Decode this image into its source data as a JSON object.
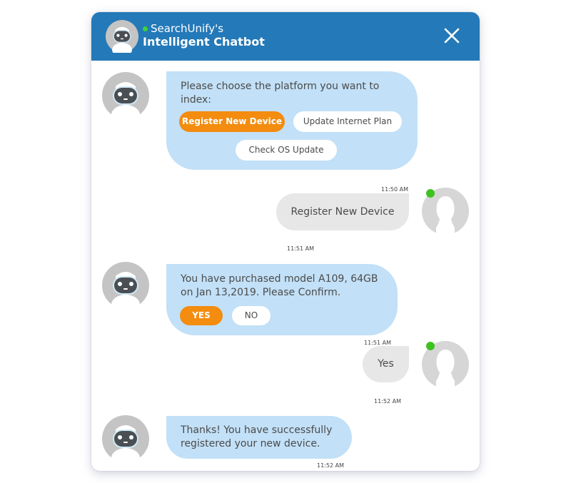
{
  "header": {
    "brand": "SearchUnify's",
    "title": "Intelligent Chatbot",
    "online_color": "#3fd13a",
    "accent": "#2479b8",
    "close_icon": "close-icon"
  },
  "messages": [
    {
      "sender": "bot",
      "text": "Please choose the platform you want to index:",
      "options": [
        "Register New Device",
        "Update Internet Plan",
        "Check OS Update"
      ],
      "selected": "Register New Device",
      "time": "11:50 AM"
    },
    {
      "sender": "user",
      "text": "Register New Device",
      "time": "11:51 AM"
    },
    {
      "sender": "bot",
      "text": "You have purchased model A109, 64GB on Jan 13,2019. Please Confirm.",
      "options": [
        "YES",
        "NO"
      ],
      "selected": "YES",
      "time": "11:51 AM"
    },
    {
      "sender": "user",
      "text": "Yes",
      "time": "11:52 AM"
    },
    {
      "sender": "bot",
      "text": "Thanks! You have successfully registered your new device.",
      "time": "11:52 AM"
    }
  ],
  "colors": {
    "bot_bubble": "#c2e0f7",
    "user_bubble": "#e7e7e7",
    "option_selected": "#f38c0f"
  }
}
